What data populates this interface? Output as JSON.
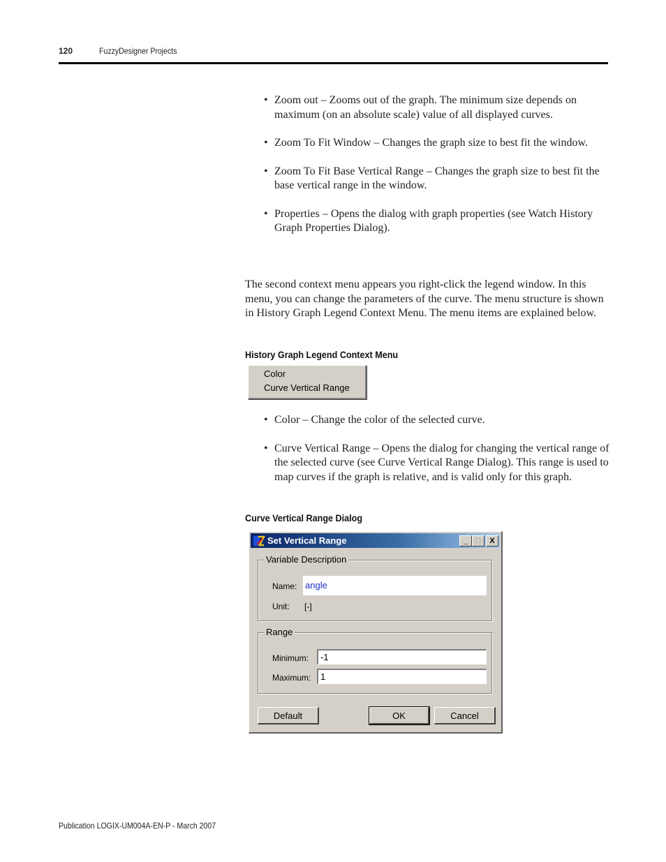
{
  "header": {
    "page_number": "120",
    "section_title": "FuzzyDesigner Projects"
  },
  "bullets_top": [
    "Zoom out – Zooms out of the graph. The minimum size depends on maximum (on an absolute scale) value of all displayed curves.",
    "Zoom To Fit Window – Changes the graph size to best fit the window.",
    "Zoom To Fit Base Vertical Range – Changes the graph size to best fit the base vertical range in the window.",
    "Properties – Opens the dialog with graph properties (see Watch History Graph Properties Dialog)."
  ],
  "paragraph": "The second context menu appears you right-click the legend window. In this menu, you can change the parameters of the curve. The menu structure is shown in History Graph Legend Context Menu. The menu items are explained below.",
  "context_menu": {
    "caption": "History Graph Legend Context Menu",
    "items": [
      "Color",
      "Curve Vertical Range"
    ]
  },
  "bullets_bottom": [
    "Color – Change the color of the selected curve.",
    "Curve Vertical Range – Opens the dialog for changing the vertical range of the selected curve (see Curve Vertical Range Dialog). This range is used to map curves if the graph is relative, and is valid only for this graph."
  ],
  "dialog": {
    "caption": "Curve Vertical Range Dialog",
    "title": "Set Vertical Range",
    "title_buttons": {
      "minimize": "_",
      "maximize": "□",
      "close": "X"
    },
    "variable_group": {
      "legend": "Variable Description",
      "name_label": "Name:",
      "name_value": "angle",
      "unit_label": "Unit:",
      "unit_value": "[-]"
    },
    "range_group": {
      "legend": "Range",
      "minimum_label": "Minimum:",
      "minimum_value": "-1",
      "maximum_label": "Maximum:",
      "maximum_value": "1"
    },
    "buttons": {
      "default": "Default",
      "ok": "OK",
      "cancel": "Cancel"
    }
  },
  "footer": "Publication LOGIX-UM004A-EN-P - March 2007"
}
